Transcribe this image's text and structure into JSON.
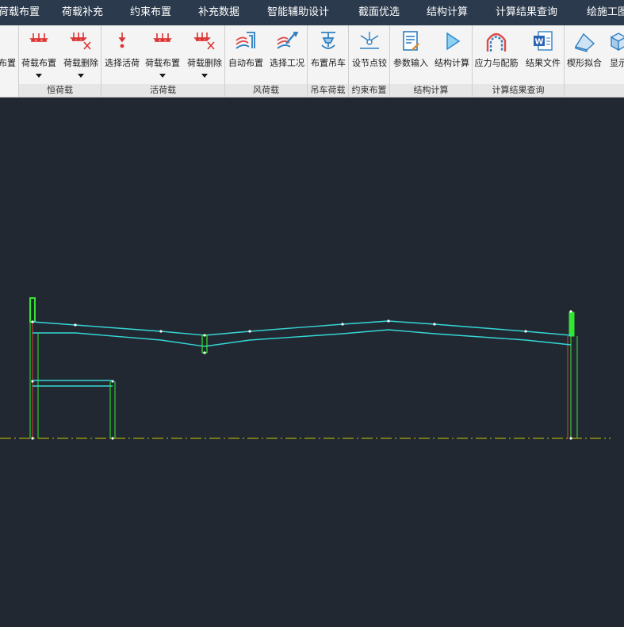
{
  "menu": [
    "荷载布置",
    "荷载补充",
    "约束布置",
    "补充数据",
    "智能辅助设计",
    "截面优选",
    "结构计算",
    "计算结果查询",
    "绘施工图"
  ],
  "ribbon": {
    "tools": [
      {
        "label": "布置",
        "icon": "load-arrows-icon"
      },
      {
        "label": "荷载布置",
        "icon": "load-arrows-icon",
        "dropdown": true
      },
      {
        "label": "荷载删除",
        "icon": "load-delete-icon",
        "dropdown": true
      },
      {
        "label": "选择活荷",
        "icon": "single-arrow-icon"
      },
      {
        "label": "荷载布置",
        "icon": "load-arrows-icon",
        "dropdown": true
      },
      {
        "label": "荷载删除",
        "icon": "load-delete-icon",
        "dropdown": true
      },
      {
        "label": "自动布置",
        "icon": "wind-icon"
      },
      {
        "label": "选择工况",
        "icon": "wind-select-icon"
      },
      {
        "label": "布置吊车",
        "icon": "crane-icon"
      },
      {
        "label": "设节点铰",
        "icon": "hinge-icon"
      },
      {
        "label": "参数输入",
        "icon": "document-edit-icon"
      },
      {
        "label": "结构计算",
        "icon": "play-icon"
      },
      {
        "label": "应力与配筋",
        "icon": "stress-arch-icon"
      },
      {
        "label": "结果文件",
        "icon": "word-file-icon"
      },
      {
        "label": "楔形拟合",
        "icon": "wedge-icon"
      },
      {
        "label": "显示",
        "icon": "cube-icon"
      }
    ],
    "groups": [
      "恒荷载",
      "活荷载",
      "风荷载",
      "吊车荷载",
      "约束布置",
      "结构计算",
      "计算结果查询"
    ]
  },
  "colors": {
    "menubar": "#2b3a4d",
    "canvas": "#222831",
    "beam": "#35d7d7",
    "column": "#33e633",
    "red_line": "#e23b3b",
    "ground": "#c8c800"
  }
}
